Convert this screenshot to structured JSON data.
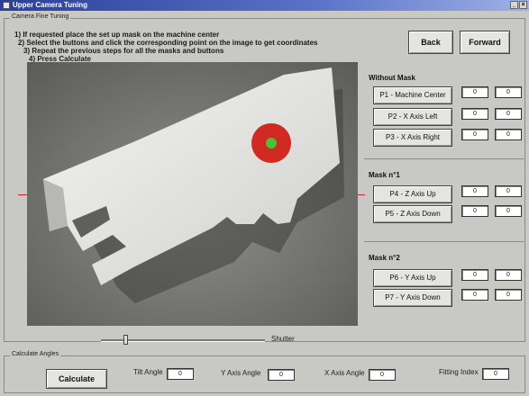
{
  "window": {
    "title": "Upper Camera Tuning"
  },
  "fine_tuning": {
    "group_title": "Camera Fine Tuning",
    "instructions": [
      "1) If requested place the set up mask on the machine center",
      "2) Select the buttons and click the corresponding point on the image to get coordinates",
      "3)  Repeat the previous steps for all the masks and buttons",
      "4) Press Calculate"
    ]
  },
  "nav": {
    "back_label": "Back",
    "forward_label": "Forward"
  },
  "without_mask": {
    "title": "Without Mask",
    "rows": [
      {
        "label": "P1 - Machine Center",
        "x": "0",
        "y": "0"
      },
      {
        "label": "P2 - X Axis Left",
        "x": "0",
        "y": "0"
      },
      {
        "label": "P3 - X Axis Right",
        "x": "0",
        "y": "0"
      }
    ]
  },
  "mask_1": {
    "title": "Mask n°1",
    "rows": [
      {
        "label": "P4 - Z Axis Up",
        "x": "0",
        "y": "0"
      },
      {
        "label": "P5 - Z Axis Down",
        "x": "0",
        "y": "0"
      }
    ]
  },
  "mask_2": {
    "title": "Mask n°2",
    "rows": [
      {
        "label": "P6 - Y Axis Up",
        "x": "0",
        "y": "0"
      },
      {
        "label": "P7 - Y Axis Down",
        "x": "0",
        "y": "0"
      }
    ]
  },
  "shutter": {
    "label": "Shutter",
    "level": 0.14
  },
  "calculate_angles": {
    "group_title": "Calculate Angles",
    "calculate_label": "Calculate",
    "tilt_label": "Tilt Angle",
    "tilt_value": "0",
    "y_axis_label": "Y Axis Angle",
    "y_axis_value": "0",
    "x_axis_label": "X Axis Angle",
    "x_axis_value": "0",
    "fitting_label": "Fitting Index",
    "fitting_value": "0"
  },
  "colors": {
    "titlebar": "#2b3f9a",
    "target_red": "#d02a22",
    "target_green": "#4bbf3a"
  }
}
